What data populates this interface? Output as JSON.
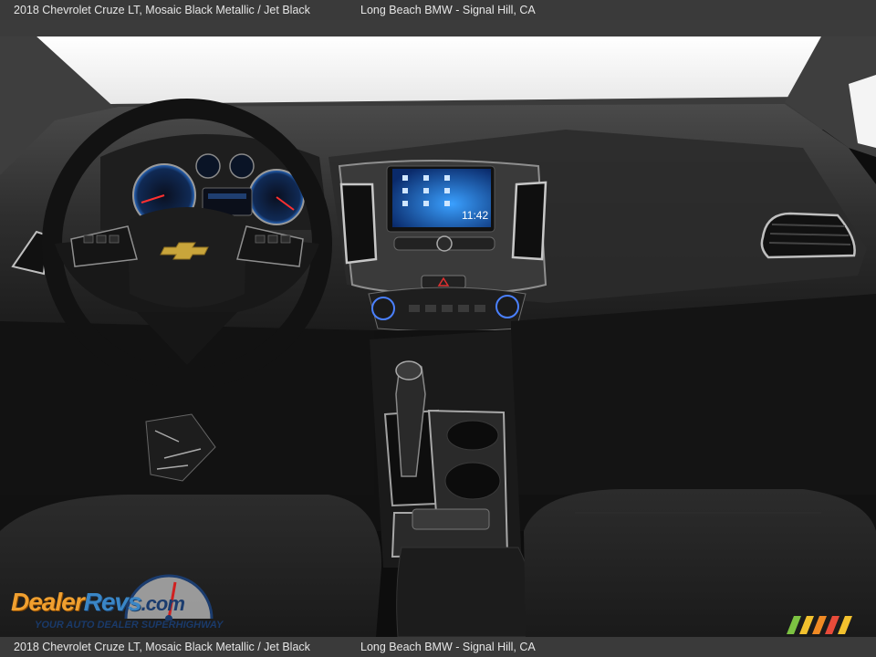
{
  "caption": {
    "vehicle": "2018 Chevrolet Cruze LT,  Mosaic Black Metallic / Jet Black",
    "dealer": "Long Beach BMW - Signal Hill, CA"
  },
  "photo": {
    "infotainment_time": "11:42"
  },
  "watermark": {
    "brand_part1": "Dealer",
    "brand_part2": "Revs",
    "brand_part3": ".com",
    "tagline": "YOUR AUTO DEALER SUPERHIGHWAY"
  },
  "colors": {
    "bar_bg": "#3a3a3a",
    "bar_text": "#e6e6e6",
    "brand_orange": "#f0a030",
    "brand_blue": "#3a86c6"
  }
}
